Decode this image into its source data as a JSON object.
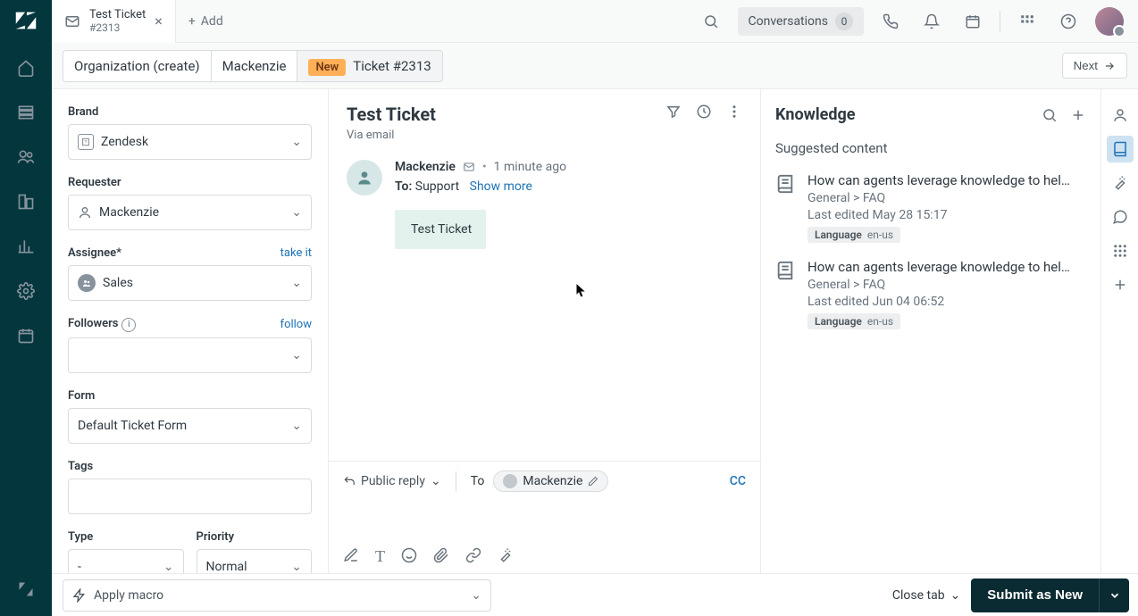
{
  "header": {
    "tab_title": "Test Ticket",
    "tab_subtitle": "#2313",
    "add_label": "Add",
    "conversations_label": "Conversations",
    "conversations_count": "0"
  },
  "breadcrumb": {
    "org": "Organization (create)",
    "user": "Mackenzie",
    "badge": "New",
    "ticket": "Ticket #2313",
    "next": "Next"
  },
  "sidebar": {
    "brand_label": "Brand",
    "brand_value": "Zendesk",
    "requester_label": "Requester",
    "requester_value": "Mackenzie",
    "assignee_label": "Assignee*",
    "assignee_value": "Sales",
    "take_it": "take it",
    "followers_label": "Followers",
    "follow": "follow",
    "form_label": "Form",
    "form_value": "Default Ticket Form",
    "tags_label": "Tags",
    "type_label": "Type",
    "type_value": "-",
    "priority_label": "Priority",
    "priority_value": "Normal"
  },
  "ticket": {
    "title": "Test Ticket",
    "via": "Via email",
    "author": "Mackenzie",
    "time": "1 minute ago",
    "to_label": "To:",
    "to_value": "Support",
    "show_more": "Show more",
    "body": "Test Ticket"
  },
  "composer": {
    "reply_type": "Public reply",
    "to_label": "To",
    "to_chip": "Mackenzie",
    "cc": "CC"
  },
  "knowledge": {
    "title": "Knowledge",
    "subhead": "Suggested content",
    "article1": {
      "title": "How can agents leverage knowledge to help …",
      "breadcrumb": "General > FAQ",
      "edited": "Last edited May 28 15:17",
      "lang_label": "Language",
      "lang_value": "en-us"
    },
    "article2": {
      "title": "How can agents leverage knowledge to help …",
      "breadcrumb": "General > FAQ",
      "edited": "Last edited Jun 04 06:52",
      "lang_label": "Language",
      "lang_value": "en-us"
    }
  },
  "footer": {
    "macro": "Apply macro",
    "close_tab": "Close tab",
    "submit": "Submit as New"
  }
}
